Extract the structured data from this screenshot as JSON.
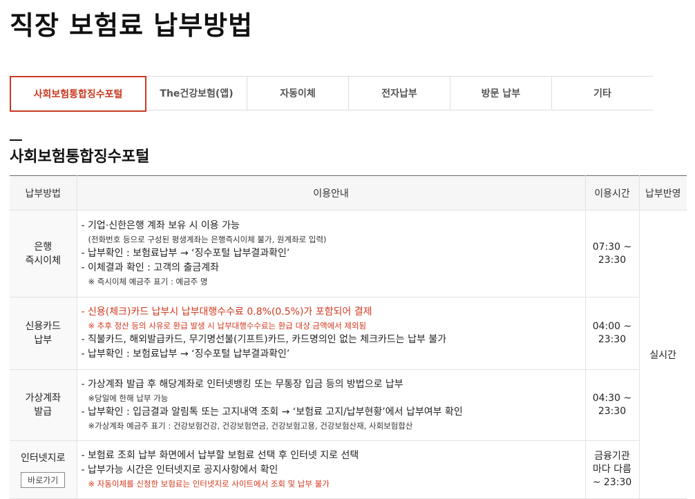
{
  "page": {
    "title": "직장 보험료 납부방법"
  },
  "tabs": [
    {
      "label": "사회보험통합징수포털",
      "active": true
    },
    {
      "label": "The건강보험(앱)"
    },
    {
      "label": "자동이체"
    },
    {
      "label": "전자납부"
    },
    {
      "label": "방문 납부"
    },
    {
      "label": "기타"
    }
  ],
  "section": {
    "title": "사회보험통합징수포털"
  },
  "table": {
    "headers": [
      "납부방법",
      "이용안내",
      "이용시간",
      "납부반영"
    ],
    "reflect": "실시간",
    "rows": [
      {
        "method": [
          "은행",
          "즉시이체"
        ],
        "guide": [
          {
            "text": "- 기업·신한은행 계좌 보유 시 이용 가능",
            "kind": "line"
          },
          {
            "text": "(전화번호 등으로 구성된 평생계좌는 은행즉시이체 불가, 원계좌로 입력)",
            "kind": "note"
          },
          {
            "text": "- 납부확인 : 보험료납부 → ‘징수포털 납부결과확인’",
            "kind": "line"
          },
          {
            "text": "- 이체결과 확인 : 고객의 출금계좌",
            "kind": "line"
          },
          {
            "text": "※ 즉시이체 예금주 표기 : 예금주 명",
            "kind": "note"
          }
        ],
        "time": [
          "07:30 ~",
          "23:30"
        ]
      },
      {
        "method": [
          "신용카드",
          "납부"
        ],
        "guide": [
          {
            "text": "- 신용(체크)카드 납부시 납부대행수수료 0.8%(0.5%)가 포함되어 결제",
            "kind": "line",
            "red": true
          },
          {
            "text": "※ 추후 정산 등의 사유로 환급 발생 시 납부대행수수료는 환급 대상 금액에서 제외됨",
            "kind": "note",
            "red": true
          },
          {
            "text": "- 직불카드, 해외발급카드, 무기명선불(기프트)카드, 카드명의인 없는 체크카드는 납부 불가",
            "kind": "line"
          },
          {
            "text": "- 납부확인 : 보험료납부 → ‘징수포털 납부결과확인’",
            "kind": "line"
          }
        ],
        "time": [
          "04:00 ~",
          "23:30"
        ]
      },
      {
        "method": [
          "가상계좌",
          "발급"
        ],
        "guide": [
          {
            "text": "- 가상계좌 발급 후 해당계좌로 인터넷뱅킹 또는 무통장 입금 등의 방법으로 납부",
            "kind": "line"
          },
          {
            "text": "※당일에 한해 납부 가능",
            "kind": "note"
          },
          {
            "text": "- 납부확인 : 입금결과 알림톡 또는 고지내역 조회 → ‘보험료 고지/납부현황’에서 납부여부 확인",
            "kind": "line"
          },
          {
            "text": "※가상계좌 예금주 표기 : 건강보험건강, 건강보험연금, 건강보험고용, 건강보험산재, 사회보험합산",
            "kind": "note"
          }
        ],
        "time": [
          "04:30 ~",
          "23:30"
        ]
      },
      {
        "method": [
          "인터넷지로"
        ],
        "button": "바로가기",
        "guide": [
          {
            "text": "- 보험료 조회 납부 화면에서 납부할 보험료 선택 후 인터넷 지로 선택",
            "kind": "line"
          },
          {
            "text": "- 납부가능 시간은 인터넷지로 공지사항에서 확인",
            "kind": "line"
          },
          {
            "text": "※ 자동이체를 신청한 보험료는 인터넷지로 사이트에서 조회 및 납부 불가",
            "kind": "note",
            "red": true
          }
        ],
        "time": [
          "금융기관",
          "마다 다름",
          "~ 23:30"
        ]
      }
    ]
  }
}
